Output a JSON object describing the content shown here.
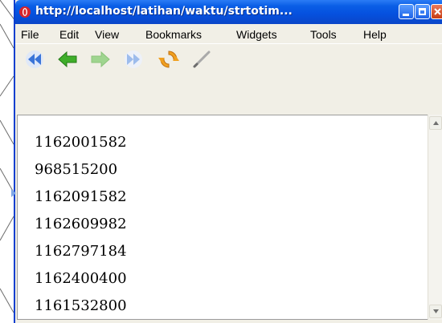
{
  "window": {
    "title": "http://localhost/latihan/waktu/strtotim..."
  },
  "menu": {
    "items": [
      "File",
      "Edit",
      "View",
      "Bookmarks",
      "Widgets",
      "Tools",
      "Help"
    ]
  },
  "toolbar": {
    "icons": [
      "rewind-icon",
      "back-arrow-icon",
      "forward-arrow-icon",
      "fast-forward-icon",
      "reload-icon",
      "edit-pen-icon"
    ]
  },
  "content": {
    "lines": [
      "1162001582",
      "968515200",
      "1162091582",
      "1162609982",
      "1162797184",
      "1162400400",
      "1161532800"
    ]
  },
  "colors": {
    "titlebar": "#0550de",
    "chrome": "#f1efe6",
    "accent_green": "#3fae2a",
    "accent_blue": "#3a74d8",
    "reload_orange": "#f0a020"
  }
}
